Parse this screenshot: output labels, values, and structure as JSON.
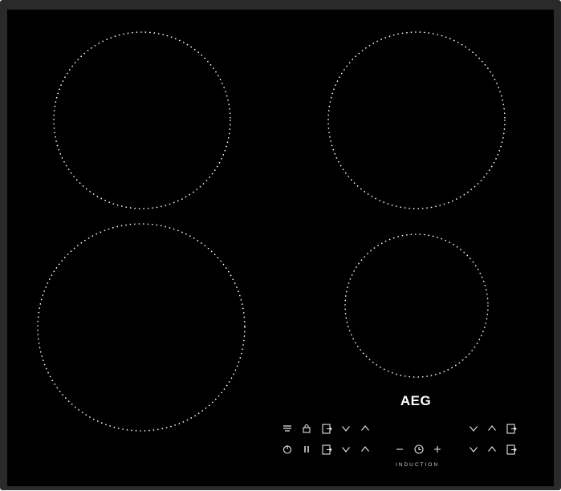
{
  "appliance": {
    "brand": "AEG",
    "technology": "INDUCTION",
    "colors": {
      "glass": "#000000",
      "frame": "#2a2a2c",
      "zone_marking": "#ffffff",
      "control_symbols": "#e6e6e6"
    },
    "cooking_zones": [
      {
        "name": "rear-left"
      },
      {
        "name": "rear-right"
      },
      {
        "name": "front-left"
      },
      {
        "name": "front-right"
      }
    ],
    "controls": {
      "left_top": [
        "bridge-icon",
        "lock-icon",
        "zone-select-icon",
        "chevron-down-icon",
        "chevron-up-icon"
      ],
      "left_bottom": [
        "power-icon",
        "pause-icon",
        "zone-select-icon",
        "chevron-down-icon",
        "chevron-up-icon"
      ],
      "timer": [
        "minus-icon",
        "clock-icon",
        "plus-icon"
      ],
      "right_top": [
        "chevron-down-icon",
        "chevron-up-icon",
        "zone-select-icon"
      ],
      "right_bottom": [
        "chevron-down-icon",
        "chevron-up-icon",
        "zone-select-icon"
      ]
    }
  }
}
